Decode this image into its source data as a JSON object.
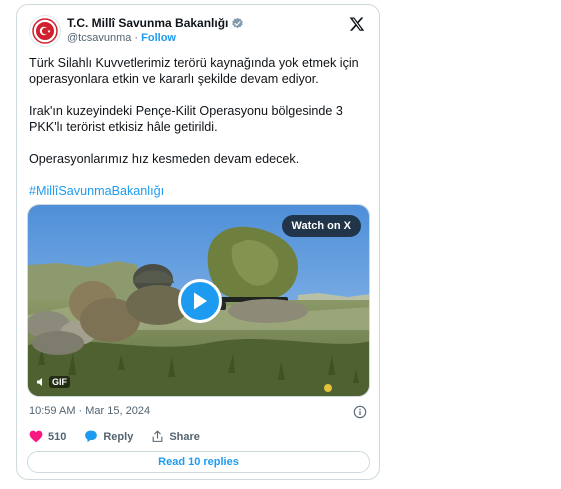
{
  "account": {
    "name": "T.C. Millî Savunma Bakanlığı",
    "handle": "@tcsavunma",
    "separator": "·",
    "follow_label": "Follow",
    "verified": true
  },
  "tweet": {
    "paragraphs": [
      "Türk Silahlı Kuvvetlerimiz terörü kaynağında yok etmek için operasyonlara etkin ve kararlı şekilde devam ediyor.",
      "Irak'ın kuzeyindeki Pençe-Kilit Operasyonu bölgesinde 3 PKK'lı terörist etkisiz hâle getirildi.",
      "Operasyonlarımız hız kesmeden devam edecek."
    ],
    "hashtag": "#MillîSavunmaBakanlığı",
    "timestamp": "10:59 AM · Mar 15, 2024"
  },
  "media": {
    "watch_label": "Watch on X",
    "gif_label": "GIF"
  },
  "actions": {
    "likes": "510",
    "reply_label": "Reply",
    "share_label": "Share"
  },
  "footer": {
    "read_replies_label": "Read 10 replies"
  },
  "colors": {
    "accent": "#1d9bf0",
    "like": "#f91880",
    "text": "#0f1419",
    "muted": "#536471"
  }
}
